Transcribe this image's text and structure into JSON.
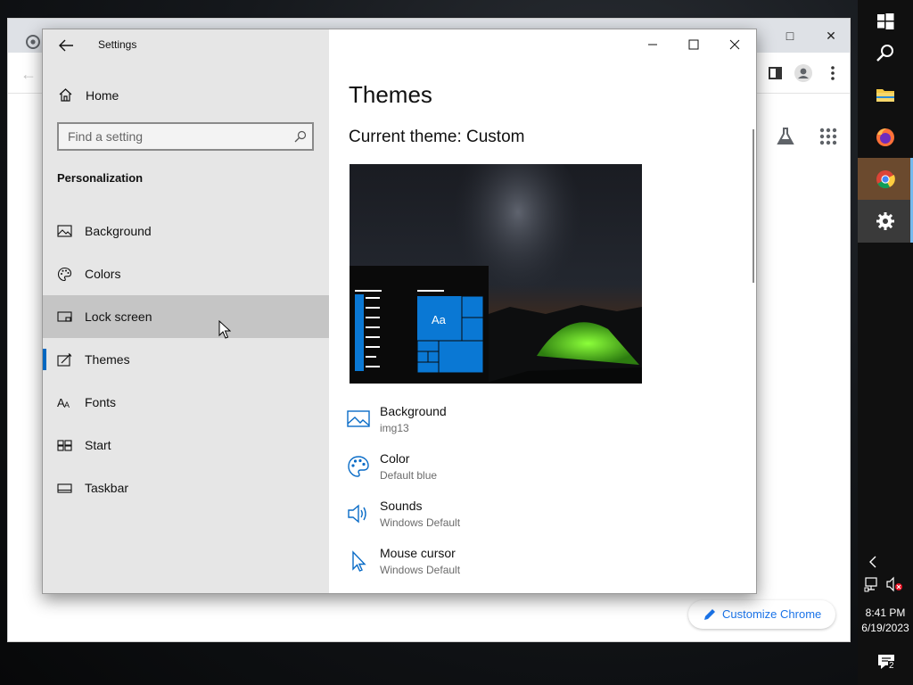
{
  "settings": {
    "app_title": "Settings",
    "home_label": "Home",
    "search_placeholder": "Find a setting",
    "section_title": "Personalization",
    "nav": [
      {
        "label": "Background"
      },
      {
        "label": "Colors"
      },
      {
        "label": "Lock screen"
      },
      {
        "label": "Themes"
      },
      {
        "label": "Fonts"
      },
      {
        "label": "Start"
      },
      {
        "label": "Taskbar"
      }
    ],
    "page_title": "Themes",
    "current_theme": "Current theme: Custom",
    "preview_tile_label": "Aa",
    "properties": [
      {
        "name": "Background",
        "value": "img13",
        "icon": "image-icon"
      },
      {
        "name": "Color",
        "value": "Default blue",
        "icon": "palette-icon"
      },
      {
        "name": "Sounds",
        "value": "Windows Default",
        "icon": "speaker-icon"
      },
      {
        "name": "Mouse cursor",
        "value": "Windows Default",
        "icon": "cursor-icon"
      }
    ]
  },
  "chrome": {
    "customize_label": "Customize Chrome"
  },
  "taskbar": {
    "time": "8:41 PM",
    "date": "6/19/2023",
    "notification_count": "2"
  },
  "colors": {
    "accent": "#0067c0",
    "tile_blue": "#0a78d4",
    "chrome_link": "#1a73e8"
  }
}
